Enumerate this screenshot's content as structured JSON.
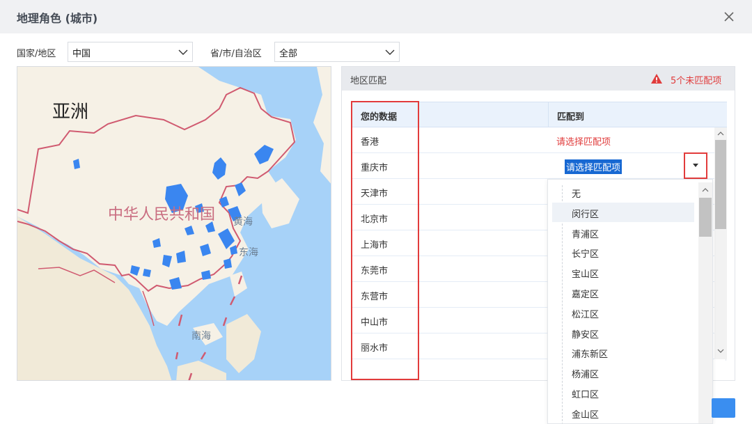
{
  "dialog": {
    "title": "地理角色 (城市)"
  },
  "filters": {
    "country_label": "国家/地区",
    "country_value": "中国",
    "province_label": "省/市/自治区",
    "province_value": "全部"
  },
  "map": {
    "labels": {
      "asia": "亚洲",
      "china": "中华人民共和国",
      "yellow_sea": "黄海",
      "east_sea": "东海",
      "south_sea": "南海"
    },
    "colors": {
      "water": "#a7d2f8",
      "land": "#f6f1e6",
      "border": "#d05a70",
      "marker": "#3a86f0"
    }
  },
  "match_panel": {
    "title": "地区匹配",
    "unmatched": "5个未匹配项",
    "columns": {
      "your_data": "您的数据",
      "match_to": "匹配到"
    },
    "rows": [
      {
        "data": "香港",
        "match": "请选择匹配项"
      },
      {
        "data": "重庆市",
        "match": "请选择匹配项"
      },
      {
        "data": "天津市",
        "match": ""
      },
      {
        "data": "北京市",
        "match": ""
      },
      {
        "data": "上海市",
        "match": ""
      },
      {
        "data": "东莞市",
        "match": ""
      },
      {
        "data": "东营市",
        "match": ""
      },
      {
        "data": "中山市",
        "match": ""
      },
      {
        "data": "丽水市",
        "match": ""
      }
    ]
  },
  "dropdown": {
    "options": [
      "无",
      "闵行区",
      "青浦区",
      "长宁区",
      "宝山区",
      "嘉定区",
      "松江区",
      "静安区",
      "浦东新区",
      "杨浦区",
      "虹口区",
      "金山区"
    ],
    "highlighted": "闵行区"
  },
  "colors": {
    "accent": "#1768d2",
    "error": "#e03c3c",
    "highlight_box": "#e23b3b",
    "button": "#3a8ef0"
  }
}
